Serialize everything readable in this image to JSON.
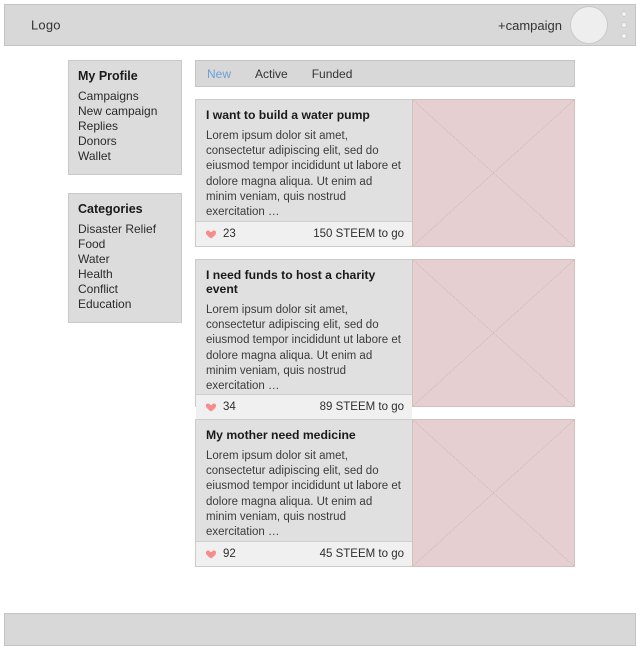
{
  "header": {
    "logo": "Logo",
    "new_campaign_label": "+campaign",
    "avatar_name": "user-avatar",
    "menu_name": "overflow-menu"
  },
  "sidebar": {
    "panels": [
      {
        "title": "My Profile",
        "items": [
          "Campaigns",
          "New campaign",
          "Replies",
          "Donors",
          "Wallet"
        ]
      },
      {
        "title": "Categories",
        "items": [
          "Disaster Relief",
          "Food",
          "Water",
          "Health",
          "Conflict",
          "Education"
        ]
      }
    ]
  },
  "main": {
    "tabs": [
      {
        "label": "New",
        "active": true
      },
      {
        "label": "Active",
        "active": false
      },
      {
        "label": "Funded",
        "active": false
      }
    ],
    "cards": [
      {
        "title": "I want to build a water pump",
        "description": "Lorem ipsum dolor sit amet, consectetur adipiscing elit, sed do eiusmod tempor incididunt ut labore et dolore magna aliqua. Ut enim ad minim veniam, quis nostrud exercitation …",
        "likes": "23",
        "goal": "150 STEEM to go"
      },
      {
        "title": "I need funds to host a charity event",
        "description": "Lorem ipsum dolor sit amet, consectetur adipiscing elit, sed do eiusmod tempor incididunt ut labore et dolore magna aliqua. Ut enim ad minim veniam, quis nostrud exercitation …",
        "likes": "34",
        "goal": "89 STEEM to go"
      },
      {
        "title": "My mother need medicine",
        "description": "Lorem ipsum dolor sit amet, consectetur adipiscing elit, sed do eiusmod tempor incididunt ut labore et dolore magna aliqua. Ut enim ad minim veniam, quis nostrud exercitation …",
        "likes": "92",
        "goal": "45 STEEM to go"
      }
    ]
  },
  "colors": {
    "accent_tab": "#6c9fd6",
    "heart": "#f98b8b",
    "chrome": "#d8d8d8",
    "card_body": "#e0e0e0",
    "card_footer": "#f0f0f0",
    "image_placeholder": "#e5cfd0"
  }
}
